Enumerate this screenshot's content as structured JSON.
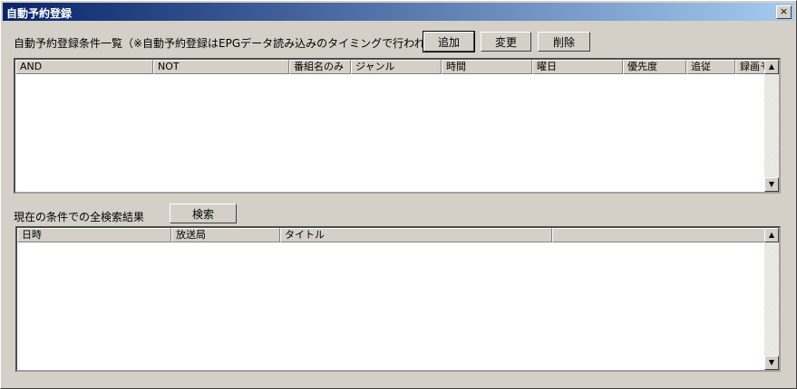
{
  "window": {
    "title": "自動予約登録",
    "close_glyph": "×"
  },
  "conditions": {
    "label": "自動予約登録条件一覧（※自動予約登録はEPGデータ読み込みのタイミングで行われます）",
    "buttons": {
      "add": "追加",
      "edit": "変更",
      "delete": "削除"
    },
    "columns": [
      "AND",
      "NOT",
      "番組名のみ",
      "ジャンル",
      "時間",
      "曜日",
      "優先度",
      "追従",
      "録画モ"
    ]
  },
  "results": {
    "label": "現在の条件での全検索結果",
    "search_button": "検索",
    "columns": [
      "日時",
      "放送局",
      "タイトル",
      ""
    ]
  },
  "icons": {
    "scroll_up": "▲",
    "scroll_down": "▼"
  }
}
